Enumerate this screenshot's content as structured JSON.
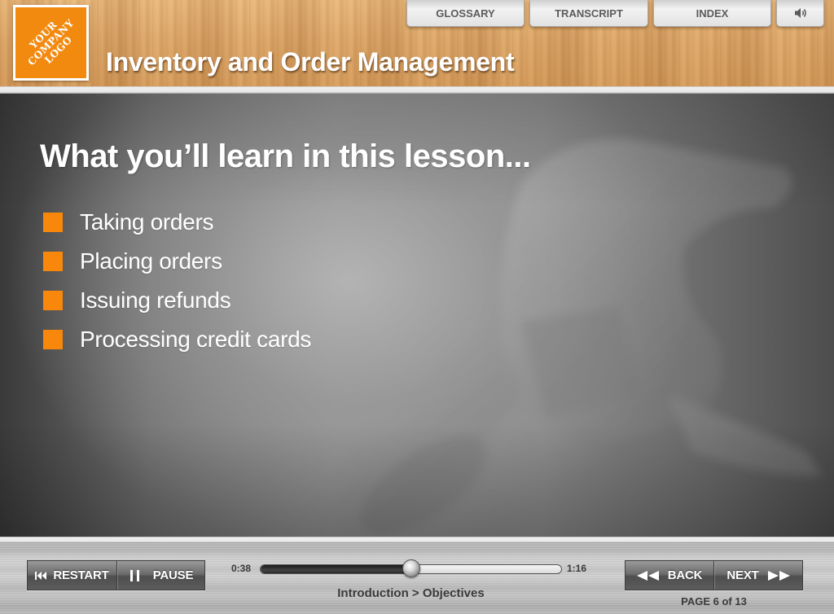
{
  "header": {
    "logo_lines": [
      "YOUR",
      "COMPANY",
      "LOGO"
    ],
    "course_title": "Inventory and Order Management",
    "buttons": [
      {
        "label": "GLOSSARY"
      },
      {
        "label": "TRANSCRIPT"
      },
      {
        "label": "INDEX"
      },
      {
        "icon": "speaker-icon",
        "glyph": "🔊︎"
      }
    ]
  },
  "slide": {
    "heading": "What you’ll learn in this lesson...",
    "bullets": [
      "Taking orders",
      "Placing orders",
      "Issuing refunds",
      "Processing credit cards"
    ],
    "bullet_color": "#f8870c"
  },
  "footer": {
    "restart": {
      "label": "RESTART",
      "glyph": "|◀◀"
    },
    "pause": {
      "label": "PAUSE",
      "glyph": "❙❙"
    },
    "back": {
      "label": "BACK",
      "glyph": "◀◀"
    },
    "next": {
      "label": "NEXT",
      "glyph": "▶▶"
    },
    "time_elapsed": "0:38",
    "time_total": "1:16",
    "progress_fraction": 0.5,
    "breadcrumb": "Introduction > Objectives",
    "page_counter": "PAGE  6 of 13"
  }
}
